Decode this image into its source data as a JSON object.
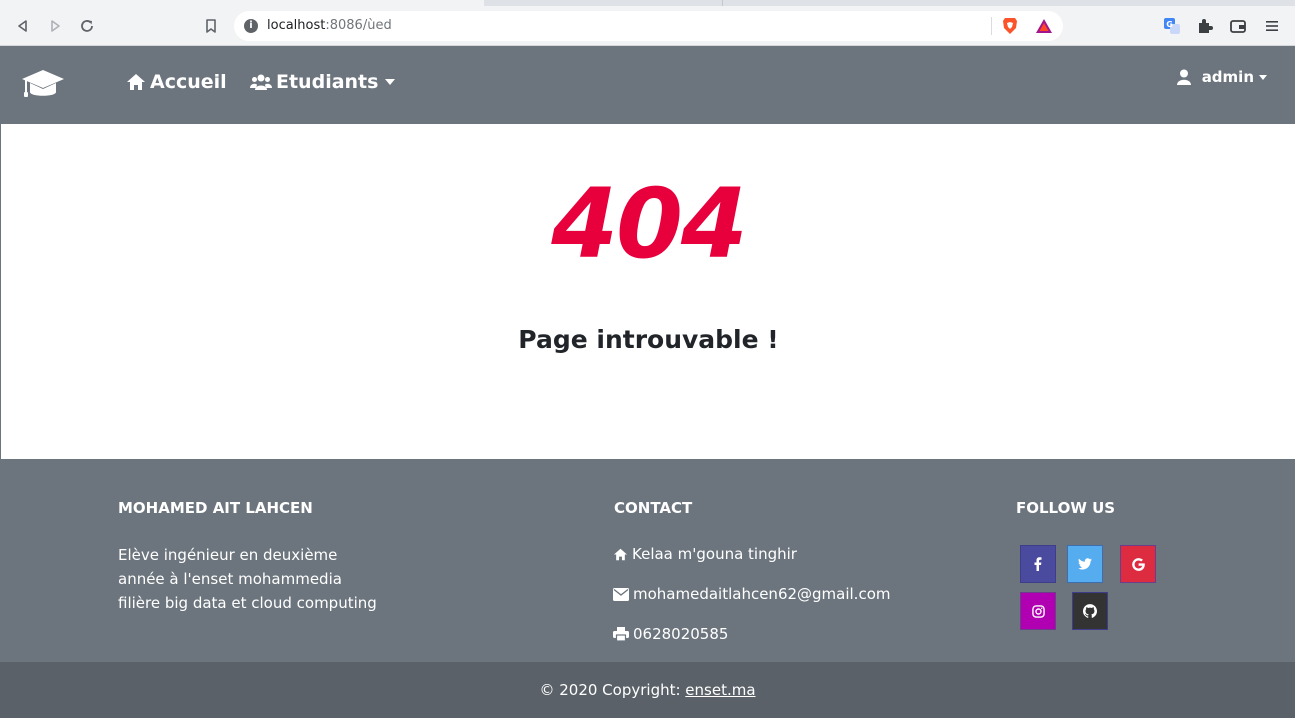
{
  "browser": {
    "url_host": "localhost",
    "url_port_path": ":8086/ùed",
    "info_icon": "i"
  },
  "navbar": {
    "brand_icon": "graduation-cap-icon",
    "links": [
      {
        "label": "Accueil",
        "icon": "home-icon"
      },
      {
        "label": "Etudiants",
        "icon": "users-icon"
      }
    ],
    "user": {
      "label": "admin",
      "icon": "user-icon"
    }
  },
  "main": {
    "code": "404",
    "message": "Page introuvable !",
    "code_color": "#e8003d"
  },
  "footer": {
    "about": {
      "heading": "MOHAMED AIT LAHCEN",
      "lines": [
        "Elève ingénieur en deuxième",
        "année à l'enset mohammedia",
        "filière big data et cloud computing"
      ]
    },
    "contact": {
      "heading": "CONTACT",
      "address": "Kelaa m'gouna tinghir",
      "email": "mohamedaitlahcen62@gmail.com",
      "phone": "0628020585"
    },
    "follow": {
      "heading": "FOLLOW US",
      "buttons": [
        {
          "name": "facebook",
          "glyph": "f",
          "color": "#3b5998"
        },
        {
          "name": "twitter",
          "glyph": "",
          "color": "#55acee"
        },
        {
          "name": "google",
          "glyph": "G",
          "color": "#dd4b39"
        },
        {
          "name": "instagram",
          "glyph": "",
          "color": "#ac2bac"
        },
        {
          "name": "github",
          "glyph": "",
          "color": "#333333"
        }
      ]
    },
    "copyright": {
      "text": "© 2020 Copyright: ",
      "link": "enset.ma"
    }
  },
  "colors": {
    "navbar_bg": "#6c757d",
    "footer_bottom_bg": "#5a6169"
  }
}
